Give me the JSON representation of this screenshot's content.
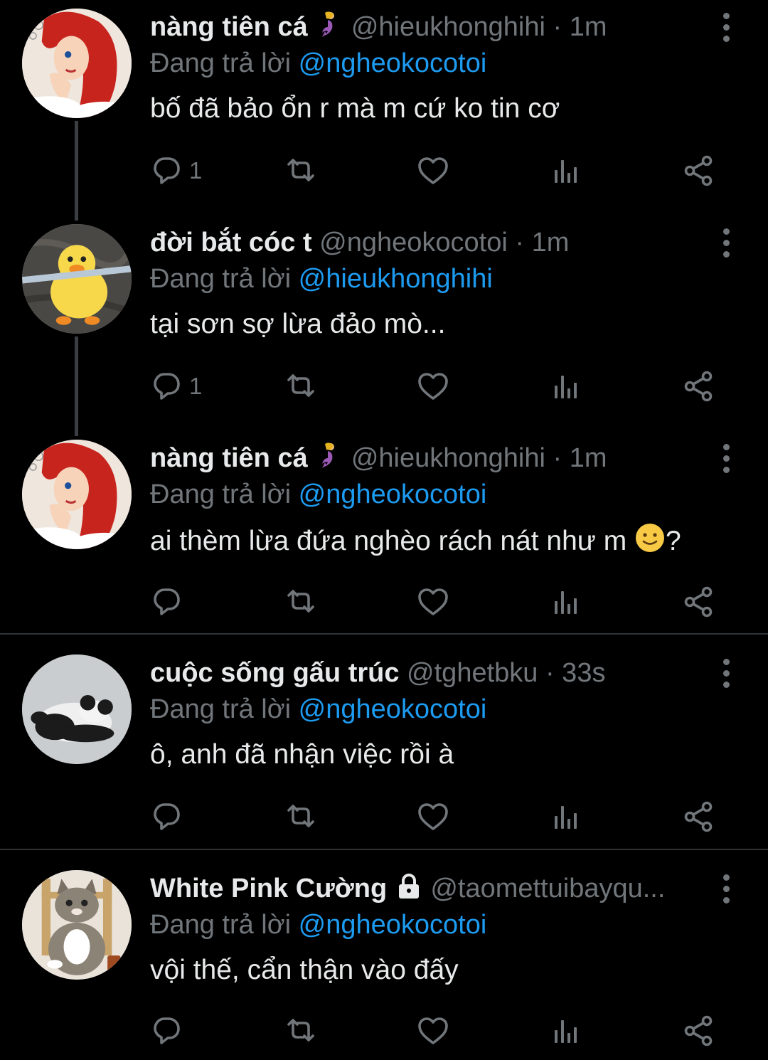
{
  "colors": {
    "background": "#000000",
    "text": "#e7e9ea",
    "muted": "#71767b",
    "link": "#1d9bf0"
  },
  "tweets": [
    {
      "name": "nàng tiên cá",
      "name_emoji": "mermaid-emoji",
      "handle": "@hieukhonghihi",
      "time": "· 1m",
      "reply_prefix": "Đang trả lời",
      "reply_to": "@ngheokocotoi",
      "text": "bố đã bảo ổn r mà m cứ ko tin cơ",
      "reply_count": "1",
      "avatar": "mermaid-avatar"
    },
    {
      "name": "đời bắt cóc t",
      "handle": "@ngheokocotoi",
      "time": "· 1m",
      "reply_prefix": "Đang trả lời",
      "reply_to": "@hieukhonghihi",
      "text": "tại sơn sợ lừa đảo mò...",
      "reply_count": "1",
      "avatar": "duck-avatar"
    },
    {
      "name": "nàng tiên cá",
      "name_emoji": "mermaid-emoji",
      "handle": "@hieukhonghihi",
      "time": "· 1m",
      "reply_prefix": "Đang trả lời",
      "reply_to": "@ngheokocotoi",
      "text": "ai thèm lừa đứa nghèo rách nát như m",
      "text_suffix": "?",
      "text_emoji": "slightly-smiling-face-emoji",
      "reply_count": "",
      "avatar": "mermaid-avatar"
    },
    {
      "name": "cuộc sống gấu trúc",
      "handle": "@tghetbku",
      "time": "· 33s",
      "reply_prefix": "Đang trả lời",
      "reply_to": "@ngheokocotoi",
      "text": "ô, anh đã nhận việc rồi à",
      "reply_count": "",
      "avatar": "panda-avatar"
    },
    {
      "name": "White Pink Cường",
      "name_icon": "lock-icon",
      "handle": "@taomettuibayqu...",
      "time": "",
      "reply_prefix": "Đang trả lời",
      "reply_to": "@ngheokocotoi",
      "text": "vội thế, cẩn thận vào đấy",
      "reply_count": "",
      "avatar": "cat-avatar"
    }
  ]
}
